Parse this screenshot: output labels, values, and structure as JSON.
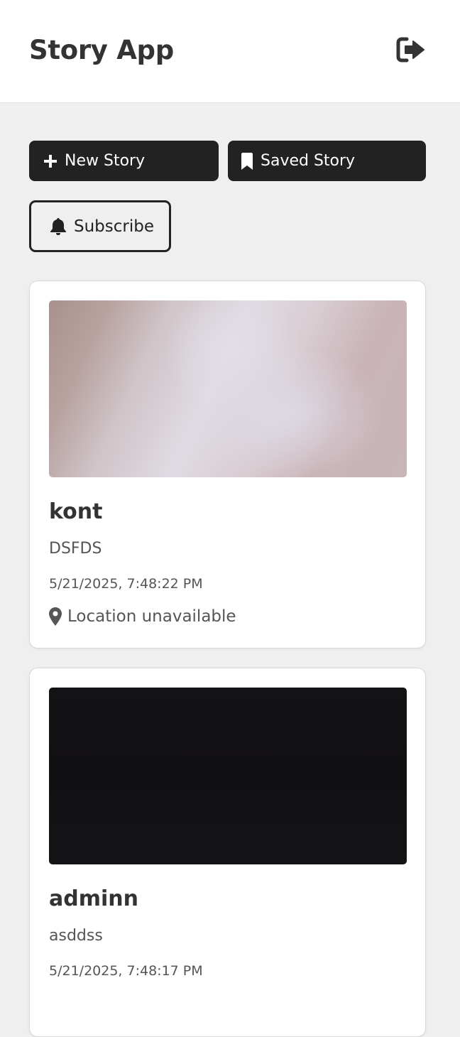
{
  "header": {
    "title": "Story App",
    "logout_icon": "sign-out-icon"
  },
  "actions": {
    "new_story_label": "New Story",
    "saved_story_label": "Saved Story",
    "subscribe_label": "Subscribe"
  },
  "colors": {
    "button_dark": "#222222",
    "page_background": "#efefef",
    "text_primary": "#333333",
    "text_secondary": "#555555"
  },
  "stories": [
    {
      "title": "kont",
      "description": "DSFDS",
      "date": "5/21/2025, 7:48:22 PM",
      "location": "Location unavailable"
    },
    {
      "title": "adminn",
      "description": "asddss",
      "date": "5/21/2025, 7:48:17 PM"
    }
  ]
}
